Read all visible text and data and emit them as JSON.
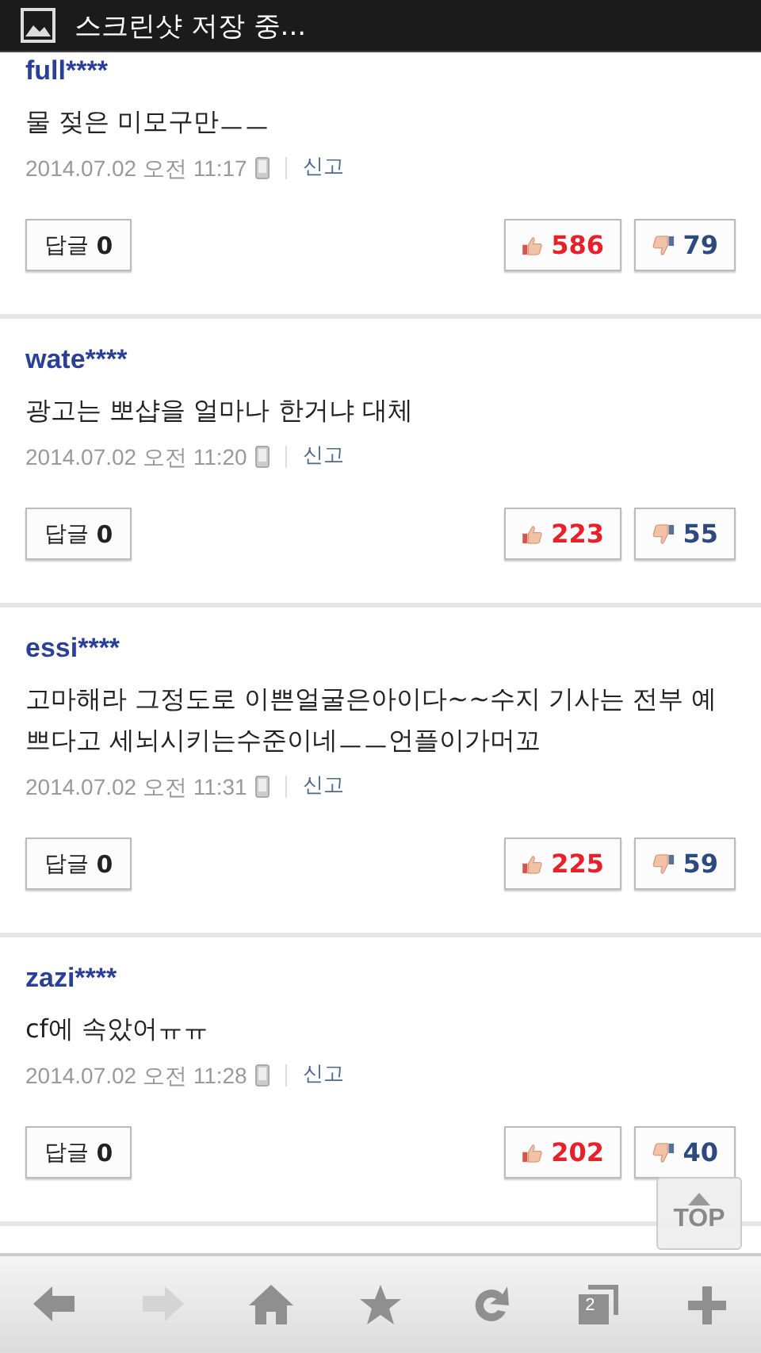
{
  "status_bar": {
    "notification": "스크린샷 저장 중..."
  },
  "comments": [
    {
      "user": "full****",
      "text": "물 젖은 미모구만ㅡㅡ",
      "date": "2014.07.02 오전 11:17",
      "report": "신고",
      "reply_label": "답글",
      "reply_count": "0",
      "likes": "586",
      "dislikes": "79"
    },
    {
      "user": "wate****",
      "text": "광고는 뽀샵을 얼마나 한거냐 대체",
      "date": "2014.07.02 오전 11:20",
      "report": "신고",
      "reply_label": "답글",
      "reply_count": "0",
      "likes": "223",
      "dislikes": "55"
    },
    {
      "user": "essi****",
      "text": "고마해라 그정도로 이쁜얼굴은아이다~~수지 기사는 전부 예쁘다고 세뇌시키는수준이네ㅡㅡ언플이가머꼬",
      "date": "2014.07.02 오전 11:31",
      "report": "신고",
      "reply_label": "답글",
      "reply_count": "0",
      "likes": "225",
      "dislikes": "59"
    },
    {
      "user": "zazi****",
      "text": "cf에 속았어ㅠㅠ",
      "date": "2014.07.02 오전 11:28",
      "report": "신고",
      "reply_label": "답글",
      "reply_count": "0",
      "likes": "202",
      "dislikes": "40"
    }
  ],
  "top_button": {
    "label": "TOP"
  },
  "toolbar": [
    {
      "kind": "back",
      "disabled": false
    },
    {
      "kind": "forward",
      "disabled": true
    },
    {
      "kind": "home",
      "disabled": false
    },
    {
      "kind": "bookmark",
      "disabled": false
    },
    {
      "kind": "reload",
      "disabled": false
    },
    {
      "kind": "tabs",
      "disabled": false,
      "count": "2"
    },
    {
      "kind": "new",
      "disabled": false
    }
  ]
}
